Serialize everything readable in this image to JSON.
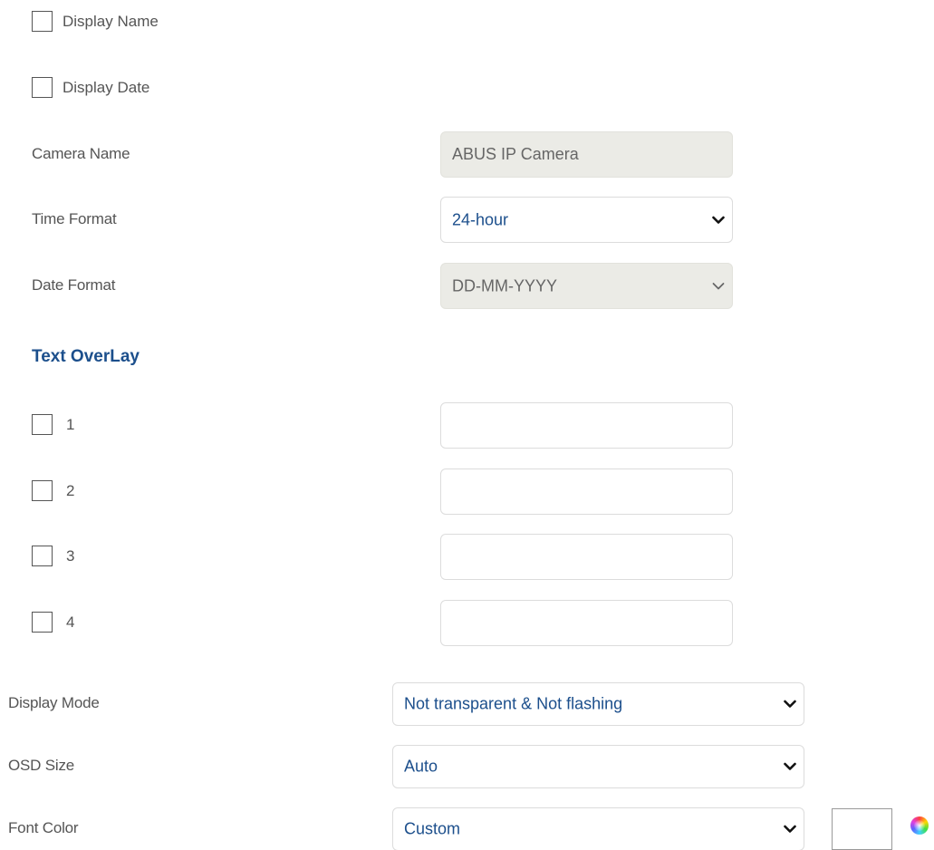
{
  "display_options": {
    "display_name": {
      "label": "Display Name",
      "checked": false
    },
    "display_date": {
      "label": "Display Date",
      "checked": false
    }
  },
  "camera_name": {
    "label": "Camera Name",
    "value": "ABUS IP Camera"
  },
  "time_format": {
    "label": "Time Format",
    "value": "24-hour"
  },
  "date_format": {
    "label": "Date Format",
    "value": "DD-MM-YYYY"
  },
  "text_overlay": {
    "title": "Text OverLay",
    "rows": [
      {
        "label": "1",
        "checked": false,
        "value": ""
      },
      {
        "label": "2",
        "checked": false,
        "value": ""
      },
      {
        "label": "3",
        "checked": false,
        "value": ""
      },
      {
        "label": "4",
        "checked": false,
        "value": ""
      }
    ]
  },
  "display_mode": {
    "label": "Display Mode",
    "value": "Not transparent & Not flashing"
  },
  "osd_size": {
    "label": "OSD Size",
    "value": "Auto"
  },
  "font_color": {
    "label": "Font Color",
    "value": "Custom",
    "swatch_color": "#ffffff"
  },
  "colors": {
    "accent": "#1c4f8c",
    "label": "#555555",
    "disabled_bg": "#ebebe6"
  }
}
